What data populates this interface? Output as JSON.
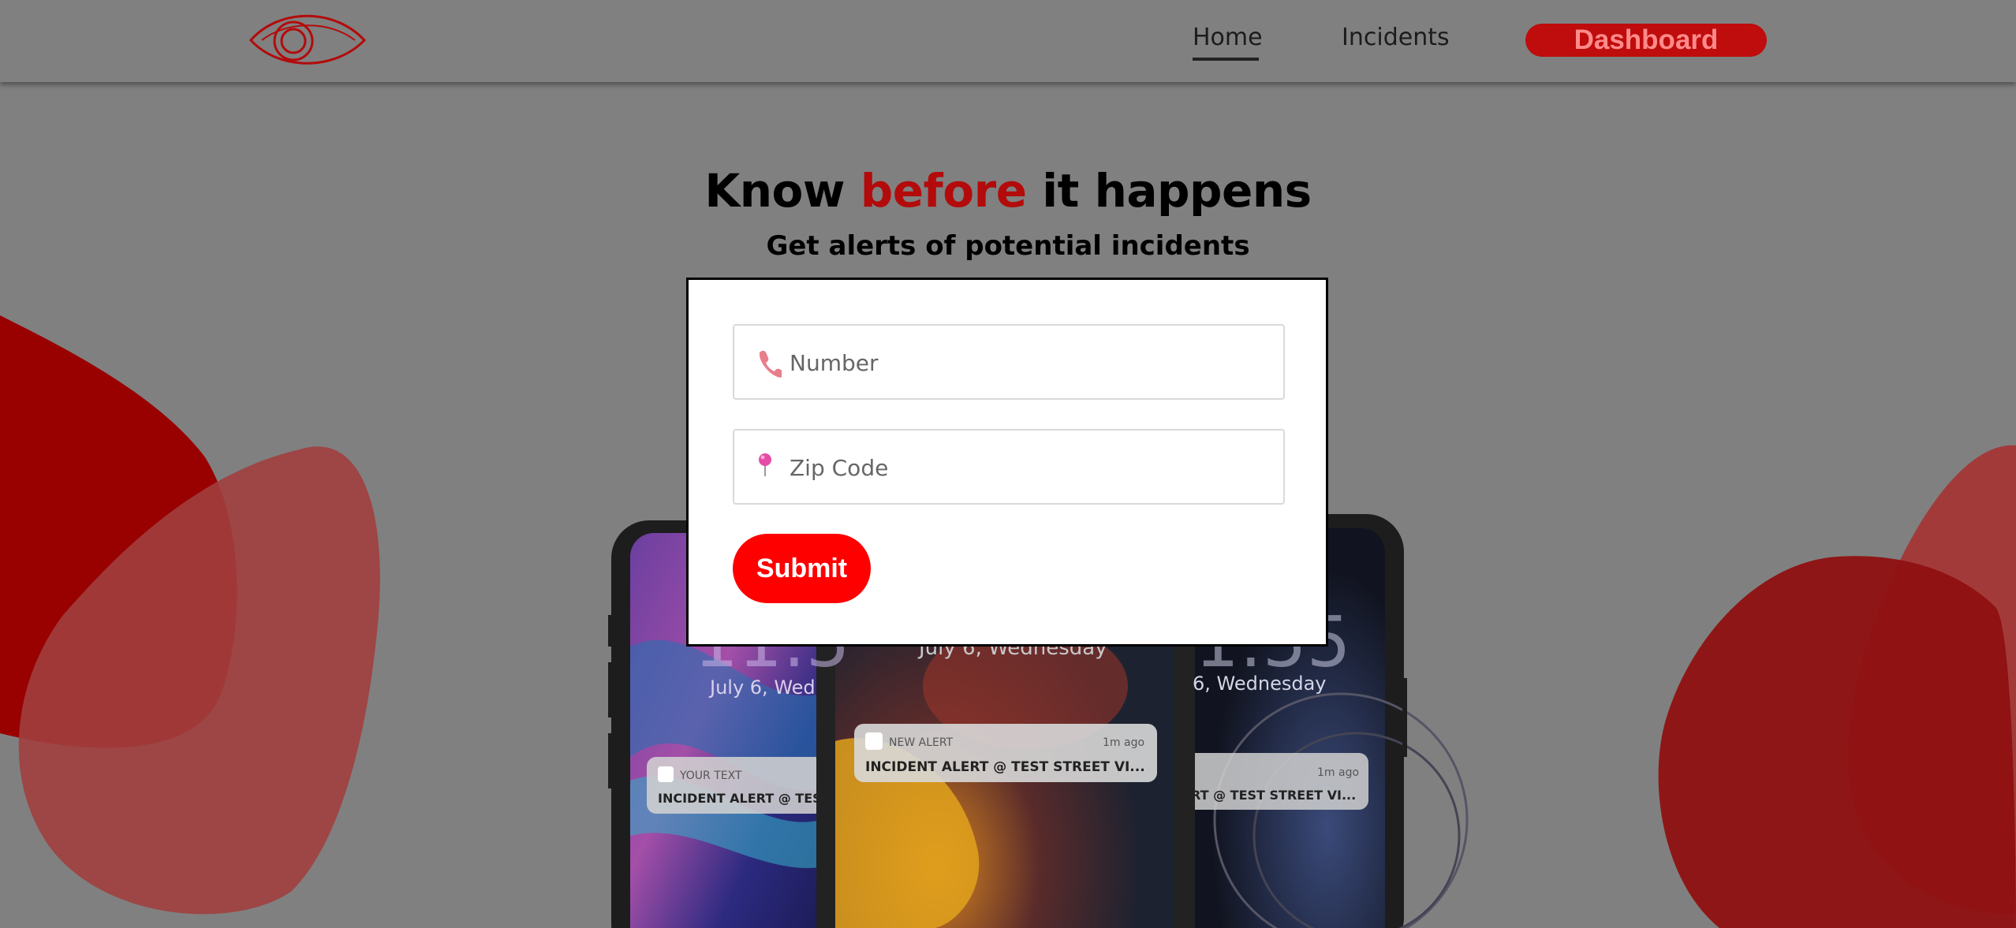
{
  "nav": {
    "logo_icon": "eye-icon",
    "home_label": "Home",
    "incidents_label": "Incidents",
    "dashboard_label": "Dashboard"
  },
  "hero": {
    "title_part1": "Know",
    "title_highlight": "before",
    "title_part2": "it happens",
    "subtitle": "Get alerts of potential incidents"
  },
  "form": {
    "number_placeholder": "Number",
    "number_icon": "phone-icon",
    "zip_placeholder": "Zip Code",
    "zip_icon": "pin-icon",
    "submit_label": "Submit"
  },
  "phones": {
    "left": {
      "time": "11:5",
      "date": "July 6, Wed",
      "notif_app": "YOUR TEXT",
      "notif_body": "INCIDENT ALERT @ TEST"
    },
    "center": {
      "date": "July 6, Wednesday",
      "notif_app": "NEW ALERT",
      "notif_time": "1m ago",
      "notif_body": "INCIDENT ALERT @ TEST STREET VI..."
    },
    "right": {
      "time": "1:55",
      "date": "6, Wednesday",
      "notif_time": "1m ago",
      "notif_body": "RT @ TEST STREET VI..."
    }
  },
  "colors": {
    "background": "#808080",
    "accent_red": "#b30b0b",
    "dashboard_bg": "#bf0c0c",
    "submit_bg": "#ff0000"
  }
}
